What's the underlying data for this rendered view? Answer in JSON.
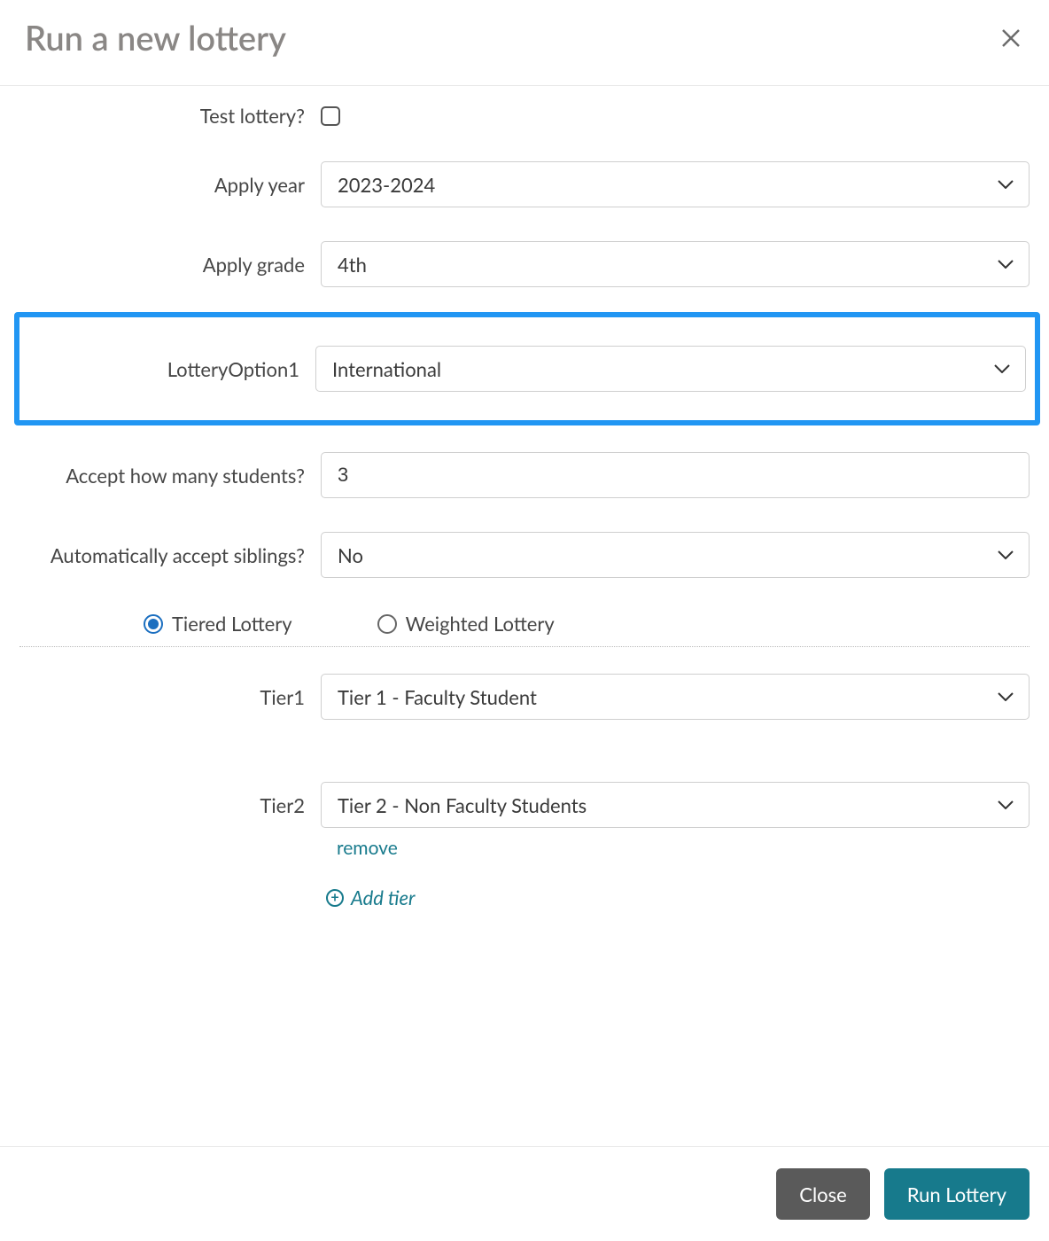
{
  "modal": {
    "title": "Run a new lottery"
  },
  "form": {
    "test_lottery_label": "Test lottery?",
    "test_lottery_checked": false,
    "apply_year_label": "Apply year",
    "apply_year_value": "2023-2024",
    "apply_grade_label": "Apply grade",
    "apply_grade_value": "4th",
    "lottery_option_label": "LotteryOption1",
    "lottery_option_value": "International",
    "accept_count_label": "Accept how many students?",
    "accept_count_value": "3",
    "auto_siblings_label": "Automatically accept siblings?",
    "auto_siblings_value": "No",
    "lottery_type": {
      "tiered_label": "Tiered Lottery",
      "weighted_label": "Weighted Lottery",
      "selected": "tiered"
    },
    "tiers": [
      {
        "label": "Tier1",
        "value": "Tier 1 - Faculty Student",
        "removable": false
      },
      {
        "label": "Tier2",
        "value": "Tier 2 - Non Faculty Students",
        "removable": true
      }
    ],
    "remove_label": "remove",
    "add_tier_label": "Add tier"
  },
  "footer": {
    "close_label": "Close",
    "run_label": "Run Lottery"
  },
  "colors": {
    "accent": "#177a8c",
    "highlight": "#2196f3"
  }
}
